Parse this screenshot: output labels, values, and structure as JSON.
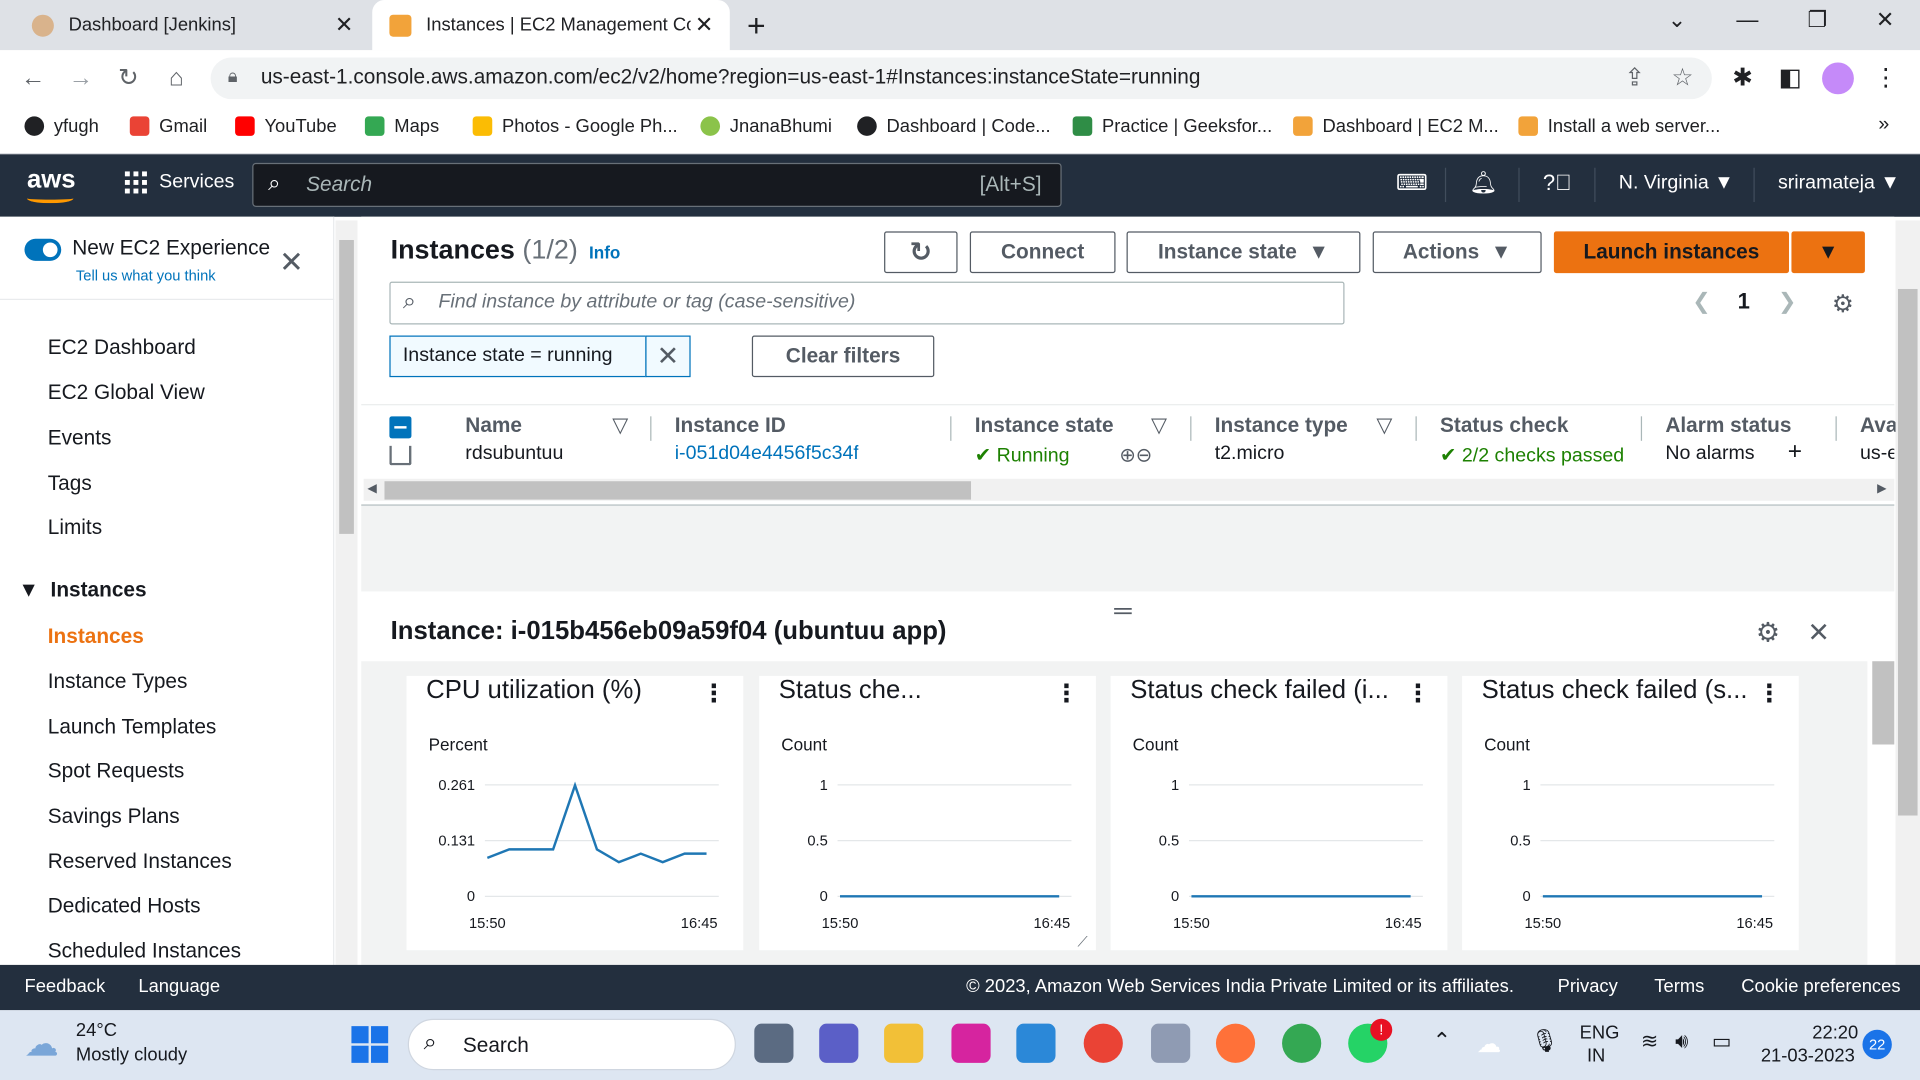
{
  "browser": {
    "tabs": [
      {
        "title": "Dashboard [Jenkins]",
        "active": false
      },
      {
        "title": "Instances | EC2 Management Cor",
        "active": true
      }
    ],
    "url": "us-east-1.console.aws.amazon.com/ec2/v2/home?region=us-east-1#Instances:instanceState=running",
    "bookmarks": [
      "yfugh",
      "Gmail",
      "YouTube",
      "Maps",
      "Photos - Google Ph...",
      "JnanaBhumi",
      "Dashboard | Code...",
      "Practice | Geeksfor...",
      "Dashboard | EC2 M...",
      "Install a web server..."
    ]
  },
  "aws_header": {
    "logo": "aws",
    "services": "Services",
    "search_placeholder": "Search",
    "search_shortcut": "[Alt+S]",
    "region": "N. Virginia",
    "account": "sriramateja"
  },
  "sidebar": {
    "new_experience": "New EC2 Experience",
    "tell_us": "Tell us what you think",
    "items": [
      "EC2 Dashboard",
      "EC2 Global View",
      "Events",
      "Tags",
      "Limits"
    ],
    "section": "Instances",
    "section_items": [
      "Instances",
      "Instance Types",
      "Launch Templates",
      "Spot Requests",
      "Savings Plans",
      "Reserved Instances",
      "Dedicated Hosts",
      "Scheduled Instances"
    ]
  },
  "instances": {
    "title": "Instances",
    "count": "(1/2)",
    "info": "Info",
    "buttons": {
      "connect": "Connect",
      "instance_state": "Instance state",
      "actions": "Actions",
      "launch": "Launch instances"
    },
    "filter_placeholder": "Find instance by attribute or tag (case-sensitive)",
    "page": "1",
    "filter_token": "Instance state = running",
    "clear_filters": "Clear filters",
    "columns": [
      "Name",
      "Instance ID",
      "Instance state",
      "Instance type",
      "Status check",
      "Alarm status",
      "Ava"
    ],
    "row": {
      "name": "rdsubuntuu",
      "id": "i-051d04e4456f5c34f",
      "state": "Running",
      "type": "t2.micro",
      "status": "2/2 checks passed",
      "alarm": "No alarms",
      "az": "us-e"
    }
  },
  "detail": {
    "title": "Instance: i-015b456eb09a59f04 (ubuntuu app)",
    "cards": [
      {
        "title": "CPU utilization (%)",
        "unit": "Percent",
        "yticks": [
          "0.261",
          "0.131",
          "0"
        ],
        "xticks": [
          "15:50",
          "16:45"
        ]
      },
      {
        "title": "Status che...",
        "unit": "Count",
        "yticks": [
          "1",
          "0.5",
          "0"
        ],
        "xticks": [
          "15:50",
          "16:45"
        ]
      },
      {
        "title": "Status check failed (i...",
        "unit": "Count",
        "yticks": [
          "1",
          "0.5",
          "0"
        ],
        "xticks": [
          "15:50",
          "16:45"
        ]
      },
      {
        "title": "Status check failed (s...",
        "unit": "Count",
        "yticks": [
          "1",
          "0.5",
          "0"
        ],
        "xticks": [
          "15:50",
          "16:45"
        ]
      }
    ]
  },
  "chart_data": [
    {
      "type": "line",
      "title": "CPU utilization (%)",
      "ylabel": "Percent",
      "x": [
        "15:50",
        "",
        "",
        "",
        "",
        "",
        "",
        "",
        "",
        "",
        "16:45"
      ],
      "series": [
        {
          "values": [
            0.09,
            0.11,
            0.11,
            0.11,
            0.26,
            0.11,
            0.08,
            0.1,
            0.08,
            0.1,
            0.1
          ]
        }
      ],
      "ylim": [
        0,
        0.261
      ]
    },
    {
      "type": "line",
      "title": "Status che...",
      "ylabel": "Count",
      "x": [
        "15:50",
        "16:45"
      ],
      "series": [
        {
          "values": [
            0,
            0
          ]
        }
      ],
      "ylim": [
        0,
        1
      ]
    },
    {
      "type": "line",
      "title": "Status check failed (i...",
      "ylabel": "Count",
      "x": [
        "15:50",
        "16:45"
      ],
      "series": [
        {
          "values": [
            0,
            0
          ]
        }
      ],
      "ylim": [
        0,
        1
      ]
    },
    {
      "type": "line",
      "title": "Status check failed (s...",
      "ylabel": "Count",
      "x": [
        "15:50",
        "16:45"
      ],
      "series": [
        {
          "values": [
            0,
            0
          ]
        }
      ],
      "ylim": [
        0,
        1
      ]
    }
  ],
  "footer": {
    "feedback": "Feedback",
    "language": "Language",
    "copyright": "© 2023, Amazon Web Services India Private Limited or its affiliates.",
    "privacy": "Privacy",
    "terms": "Terms",
    "cookies": "Cookie preferences"
  },
  "taskbar": {
    "temp": "24°C",
    "weather": "Mostly cloudy",
    "search": "Search",
    "lang1": "ENG",
    "lang2": "IN",
    "time": "22:20",
    "date": "21-03-2023",
    "notif": "22"
  },
  "colors": {
    "aws_dark": "#232f3e",
    "orange": "#ec7211",
    "link": "#0073bb",
    "green": "#1d8102"
  }
}
